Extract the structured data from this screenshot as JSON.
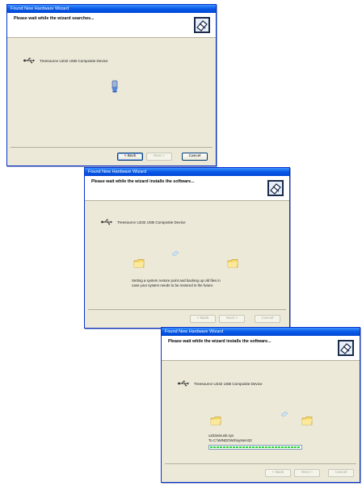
{
  "windows": [
    {
      "title": "Found New Hardware Wizard",
      "header": "Please wait while the wizard searches...",
      "device": "Treesource U232 USB Composite Device",
      "buttons": {
        "back": "< Back",
        "next": "Next >",
        "cancel": "Cancel"
      }
    },
    {
      "title": "Found New Hardware Wizard",
      "header": "Please wait while the wizard installs the software...",
      "device": "Treesource U232 USB Composite Device",
      "status_line1": "Setting a system restore point and backing up old files in",
      "status_line2": "case your system needs to be restored in the future.",
      "buttons": {
        "back": "< Back",
        "next": "Next >",
        "cancel": "Cancel"
      }
    },
    {
      "title": "Found New Hardware Wizard",
      "header": "Please wait while the wizard installs the software...",
      "device": "Treesource U232 USB Composite Device",
      "file_name": "u232winusb.sys",
      "file_dest": "To C:\\WINDOWS\\system32",
      "progress": 1.0,
      "buttons": {
        "back": "< Back",
        "next": "Next >",
        "cancel": "Cancel"
      }
    }
  ],
  "colors": {
    "titlebar": "#0a5be8",
    "dialog": "#ece9d8",
    "progress": "#2fd13b"
  },
  "icons": [
    "wizard-hardware-icon",
    "usb-icon",
    "flashlight-search-icon",
    "folder-icon",
    "paper-icon"
  ]
}
